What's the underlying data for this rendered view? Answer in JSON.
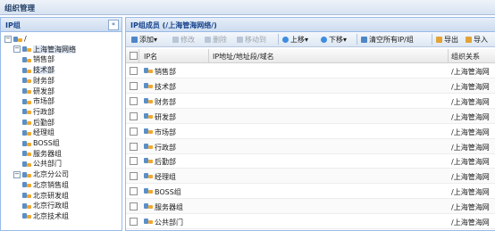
{
  "window": {
    "title": "组织管理"
  },
  "left_panel": {
    "title": "IP组",
    "collapse_glyph": "«",
    "tree": [
      {
        "label": "/",
        "level": 0,
        "expander": "⊟",
        "icon": "group-icon"
      },
      {
        "label": "上海管海网络",
        "level": 1,
        "expander": "⊟",
        "icon": "group-icon",
        "selected": true
      },
      {
        "label": "销售部",
        "level": 2
      },
      {
        "label": "技术部",
        "level": 2,
        "selected": true
      },
      {
        "label": "财务部",
        "level": 2
      },
      {
        "label": "研发部",
        "level": 2
      },
      {
        "label": "市场部",
        "level": 2
      },
      {
        "label": "行政部",
        "level": 2
      },
      {
        "label": "后勤部",
        "level": 2
      },
      {
        "label": "经理组",
        "level": 2
      },
      {
        "label": "BOSS组",
        "level": 2
      },
      {
        "label": "服务器组",
        "level": 2
      },
      {
        "label": "公共部门",
        "level": 2
      },
      {
        "label": "北京分公司",
        "level": 1,
        "expander": "⊟"
      },
      {
        "label": "北京销售组",
        "level": 2
      },
      {
        "label": "北京研发组",
        "level": 2
      },
      {
        "label": "北京行政组",
        "level": 2
      },
      {
        "label": "北京技术组",
        "level": 2
      }
    ]
  },
  "right_panel": {
    "title": "IP组成员 (/上海管海网络/)",
    "toolbar": {
      "add": "添加",
      "edit": "修改",
      "delete": "删除",
      "move_to": "移动到",
      "up": "上移",
      "down": "下移",
      "clear_ip": "清空所有IP/组",
      "export": "导出",
      "import": "导入"
    },
    "columns": {
      "name": "IP名",
      "address": "IP地址/地址段/域名",
      "relation": "组织关系"
    },
    "rows": [
      {
        "name": "销售部",
        "address": "",
        "relation": "/上海管海网"
      },
      {
        "name": "技术部",
        "address": "",
        "relation": "/上海管海网"
      },
      {
        "name": "财务部",
        "address": "",
        "relation": "/上海管海网"
      },
      {
        "name": "研发部",
        "address": "",
        "relation": "/上海管海网"
      },
      {
        "name": "市场部",
        "address": "",
        "relation": "/上海管海网"
      },
      {
        "name": "行政部",
        "address": "",
        "relation": "/上海管海网"
      },
      {
        "name": "后勤部",
        "address": "",
        "relation": "/上海管海网"
      },
      {
        "name": "经理组",
        "address": "",
        "relation": "/上海管海网"
      },
      {
        "name": "BOSS组",
        "address": "",
        "relation": "/上海管海网"
      },
      {
        "name": "服务器组",
        "address": "",
        "relation": "/上海管海网"
      },
      {
        "name": "公共部门",
        "address": "",
        "relation": "/上海管海网"
      }
    ]
  },
  "colors": {
    "accent": "#15428b",
    "header_border": "#99bbe8"
  }
}
